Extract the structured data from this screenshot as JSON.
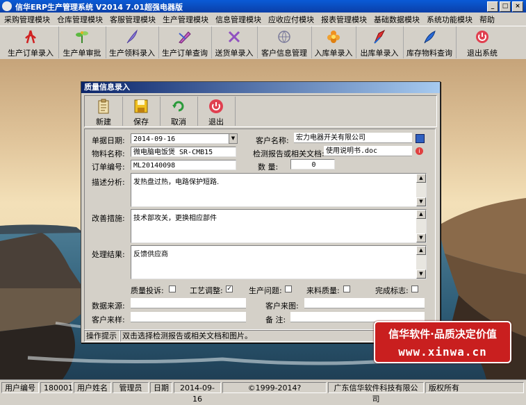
{
  "window": {
    "title": "信华ERP生产管理系统  V2014  7.01超强电器版",
    "min": "_",
    "max": "□",
    "close": "×"
  },
  "menu": [
    "采购管理模块",
    "仓库管理模块",
    "客服管理模块",
    "生产管理模块",
    "信息管理模块",
    "应收应付模块",
    "报表管理模块",
    "基础数据模块",
    "系统功能模块",
    "帮助"
  ],
  "toolbar": [
    {
      "label": "生产订单录入",
      "icon": "pdf-icon"
    },
    {
      "label": "生产单审批",
      "icon": "plant-icon"
    },
    {
      "label": "生产领料录入",
      "icon": "feather-icon"
    },
    {
      "label": "生产订单查询",
      "icon": "pen-tool-icon"
    },
    {
      "label": "送货单录入",
      "icon": "crossed-tools-icon"
    },
    {
      "label": "客户信息管理",
      "icon": "globe-icon"
    },
    {
      "label": "入库单录入",
      "icon": "flower-icon"
    },
    {
      "label": "出库单录入",
      "icon": "pen-red-icon"
    },
    {
      "label": "库存物料查询",
      "icon": "quill-icon"
    },
    {
      "label": "退出系统",
      "icon": "power-icon"
    }
  ],
  "dialog": {
    "title": "质量信息录入",
    "buttons": [
      {
        "label": "新建",
        "icon": "clipboard-icon"
      },
      {
        "label": "保存",
        "icon": "floppy-icon"
      },
      {
        "label": "取消",
        "icon": "undo-arrows-icon"
      },
      {
        "label": "退出",
        "icon": "power-icon"
      }
    ],
    "fields": {
      "date_label": "单据日期:",
      "date_value": "2014-09-16",
      "customer_label": "客户名称:",
      "customer_value": "宏力电器开关有限公司",
      "material_label": "物料名称:",
      "material_value": "微电脑电饭煲 SR-CMB15",
      "report_label": "检测报告或相关文档:",
      "report_value": "使用说明书.doc",
      "order_label": "订单编号:",
      "order_value": "ML20140098",
      "qty_label": "数 量:",
      "qty_value": "0",
      "desc_label": "描述分析:",
      "desc_value": "发热盘过热，电路保护短路.",
      "improve_label": "改善措施:",
      "improve_value": "技术部攻关，更换相应部件",
      "result_label": "处理结果:",
      "result_value": "反馈供应商",
      "source_label": "数据来源:",
      "source_value": "",
      "cust_pic_label": "客户来图:",
      "cust_pic_value": "",
      "cust_sample_label": "客户来样:",
      "cust_sample_value": "",
      "note_label": "备 注:",
      "note_value": ""
    },
    "checks": [
      {
        "label": "质量投诉:",
        "checked": false
      },
      {
        "label": "工艺调整:",
        "checked": true
      },
      {
        "label": "生产问题:",
        "checked": false
      },
      {
        "label": "来料质量:",
        "checked": false
      },
      {
        "label": "完成标志:",
        "checked": false
      }
    ],
    "hint_label": "操作提示",
    "hint_text": "双击选择检测报告或相关文档和图片。"
  },
  "banner": {
    "line1": "信华软件·品质决定价值",
    "line2": "www.xinwa.cn"
  },
  "status": {
    "user_no_label": "用户编号",
    "user_no": "180001",
    "user_name_label": "用户姓名",
    "user_name": "管理员",
    "date_label": "日期",
    "date": "2014-09-16",
    "copyright": "©1999-2014?",
    "company": "广东信华软件科技有限公司",
    "rights": "版权所有"
  },
  "colors": {
    "titlebar": "#0b3fa8",
    "banner": "#c91f1f",
    "face": "#d4d0c8"
  }
}
